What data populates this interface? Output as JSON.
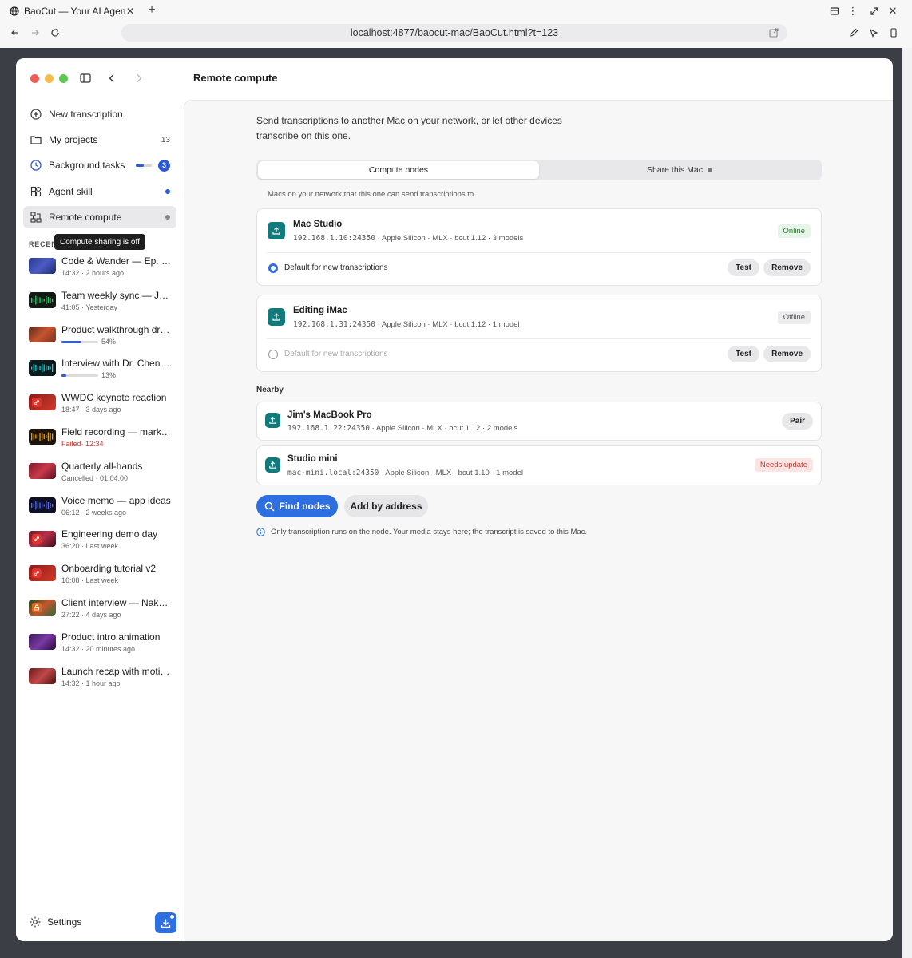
{
  "browser": {
    "tab_title": "BaoCut — Your AI Agen",
    "url": "localhost:4877/baocut-mac/BaoCut.html?t=123"
  },
  "app": {
    "page_title": "Remote compute",
    "nav": [
      {
        "label": "New transcription",
        "icon": "plus-circle-icon"
      },
      {
        "label": "My projects",
        "icon": "folder-icon",
        "count": "13"
      },
      {
        "label": "Background tasks",
        "icon": "clock-icon",
        "badge": "3"
      },
      {
        "label": "Agent skill",
        "icon": "grid-icon"
      },
      {
        "label": "Remote compute",
        "icon": "network-icon"
      }
    ],
    "recents_label": "RECEN",
    "tooltip": "Compute sharing is off",
    "recents": [
      {
        "title": "Code & Wander — Ep. 42…",
        "meta": "14:32 · 2 hours ago"
      },
      {
        "title": "Team weekly sync — Ju…",
        "meta": "41:05 · Yesterday"
      },
      {
        "title": "Product walkthrough dr…",
        "meta": "54%",
        "progress": 0.54
      },
      {
        "title": "Interview with Dr. Chen …",
        "meta": "13%",
        "progress": 0.13
      },
      {
        "title": "WWDC keynote reaction",
        "meta": "18:47 · 3 days ago"
      },
      {
        "title": "Field recording — marke…",
        "meta_status": "Failed",
        "meta": " · 12:34"
      },
      {
        "title": "Quarterly all-hands",
        "meta": "Cancelled · 01:04:00"
      },
      {
        "title": "Voice memo — app ideas",
        "meta": "06:12 · 2 weeks ago"
      },
      {
        "title": "Engineering demo day",
        "meta": "36:20 · Last week"
      },
      {
        "title": "Onboarding tutorial v2",
        "meta": "16:08 · Last week"
      },
      {
        "title": "Client interview — Naka…",
        "meta": "27:22 · 4 days ago"
      },
      {
        "title": "Product intro animation",
        "meta": "14:32 · 20 minutes ago"
      },
      {
        "title": "Launch recap with moti…",
        "meta": "14:32 · 1 hour ago"
      }
    ],
    "settings_label": "Settings"
  },
  "main": {
    "intro": "Send transcriptions to another Mac on your network, or let other devices transcribe on this one.",
    "tabs": [
      "Compute nodes",
      "Share this Mac"
    ],
    "subtitle": "Macs on your network that this one can send transcriptions to.",
    "nodes": [
      {
        "name": "Mac Studio",
        "addr": "192.168.1.10:24350",
        "meta": " · Apple Silicon · MLX · bcut 1.12 · 3 models",
        "status": "Online",
        "default_label": "Default for new transcriptions",
        "test": "Test",
        "remove": "Remove"
      },
      {
        "name": "Editing iMac",
        "addr": "192.168.1.31:24350",
        "meta": " · Apple Silicon · MLX · bcut 1.12 · 1 model",
        "status": "Offline",
        "default_label": "Default for new transcriptions",
        "test": "Test",
        "remove": "Remove"
      }
    ],
    "nearby_label": "Nearby",
    "nearby": [
      {
        "name": "Jim's MacBook Pro",
        "addr": "192.168.1.22:24350",
        "meta": " · Apple Silicon · MLX · bcut 1.12 · 2 models",
        "action": "Pair"
      },
      {
        "name": "Studio mini",
        "addr": "mac-mini.local:24350",
        "meta": " · Apple Silicon · MLX · bcut 1.10 · 1 model",
        "status": "Needs update"
      }
    ],
    "find_nodes": "Find nodes",
    "add_by_address": "Add by address",
    "note": "Only transcription runs on the node. Your media stays here; the transcript is saved to this Mac."
  },
  "colors": {
    "accent": "#2d6ee0",
    "online_bg": "#e6f4e9",
    "online_fg": "#2e7d32",
    "needs_update_bg": "#fde4e4",
    "needs_update_fg": "#c0392b",
    "failed": "#d0312d",
    "node_icon": "#127a7a"
  }
}
